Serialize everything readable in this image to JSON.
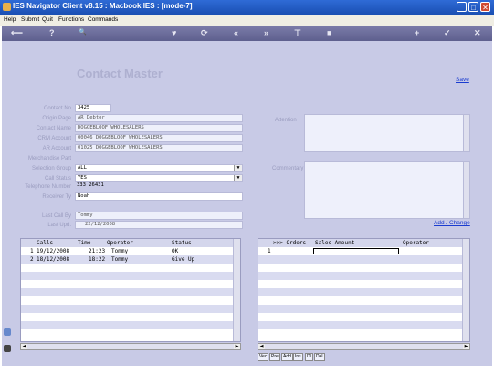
{
  "window": {
    "title": "IES Navigator Client v8.15 : Macbook IES :     [mode-7]",
    "buttons": [
      "minimize",
      "maximize",
      "close"
    ]
  },
  "menu": [
    "Help",
    "Submit",
    "Quit",
    "Functions",
    "Commands"
  ],
  "toolbar_icons": [
    "back-icon",
    "help-icon",
    "search-icon",
    "favorite-icon",
    "history-icon",
    "rewind-icon",
    "forward-icon",
    "filter-icon",
    "stop-icon",
    "add-icon",
    "confirm-icon",
    "close-icon"
  ],
  "toolbar_glyphs": [
    "⟵",
    "?",
    "🔍",
    "♥",
    "⟳",
    "«",
    "»",
    "⊤",
    "■",
    "+",
    "✓",
    "✕"
  ],
  "header": {
    "title": "Contact Master",
    "save": "Save"
  },
  "fields": [
    {
      "label": "Contact No",
      "value": "3425"
    },
    {
      "label": "Origin Page",
      "value": "AR Debtor"
    },
    {
      "label": "Contact Name",
      "value": "DOGGEBLOOF WHOLESALERS"
    },
    {
      "label": "CRM Account",
      "value": "00046 DOGGEBLOOF WHOLESALERS"
    },
    {
      "label": "AR Account",
      "value": "01025 DOGGEBLOOF WHOLESALERS"
    },
    {
      "label": "Merchandise Part",
      "value": ""
    },
    {
      "label": "Selection Group",
      "value": "ALL"
    },
    {
      "label": "Call Status",
      "value": "YES"
    },
    {
      "label": "Telephone Number",
      "value": "333 26431"
    },
    {
      "label": "Receiver Ty",
      "value": "Noah"
    },
    {
      "label": "Last Call By",
      "value": "Tommy"
    },
    {
      "label": "Last Upd.",
      "value": "22/12/2008"
    }
  ],
  "side_labels": {
    "attention": "Attention",
    "commentary": "Commentary"
  },
  "add_change": "Add / Change",
  "calls_grid": {
    "headers": [
      "Calls",
      "Time",
      "Operator",
      "Status"
    ],
    "rows": [
      {
        "n": "1",
        "date": "19/12/2008",
        "time": "21:23",
        "operator": "Tommy",
        "status": "OK"
      },
      {
        "n": "2",
        "date": "18/12/2008",
        "time": "18:22",
        "operator": "Tommy",
        "status": "Give Up"
      }
    ]
  },
  "orders_grid": {
    "headers": [
      ">>> Orders",
      "Sales Amount",
      "Operator"
    ],
    "rows": [
      {
        "n": "1"
      }
    ]
  },
  "tabs": [
    "Vec",
    "Pre",
    "Add",
    "Ins",
    "Dl",
    "Del"
  ],
  "colors": {
    "titlebar": "#1a4fb3",
    "toolbar": "#5e5f8e",
    "panel": "#c8cae6",
    "link": "#1a3cd0"
  }
}
